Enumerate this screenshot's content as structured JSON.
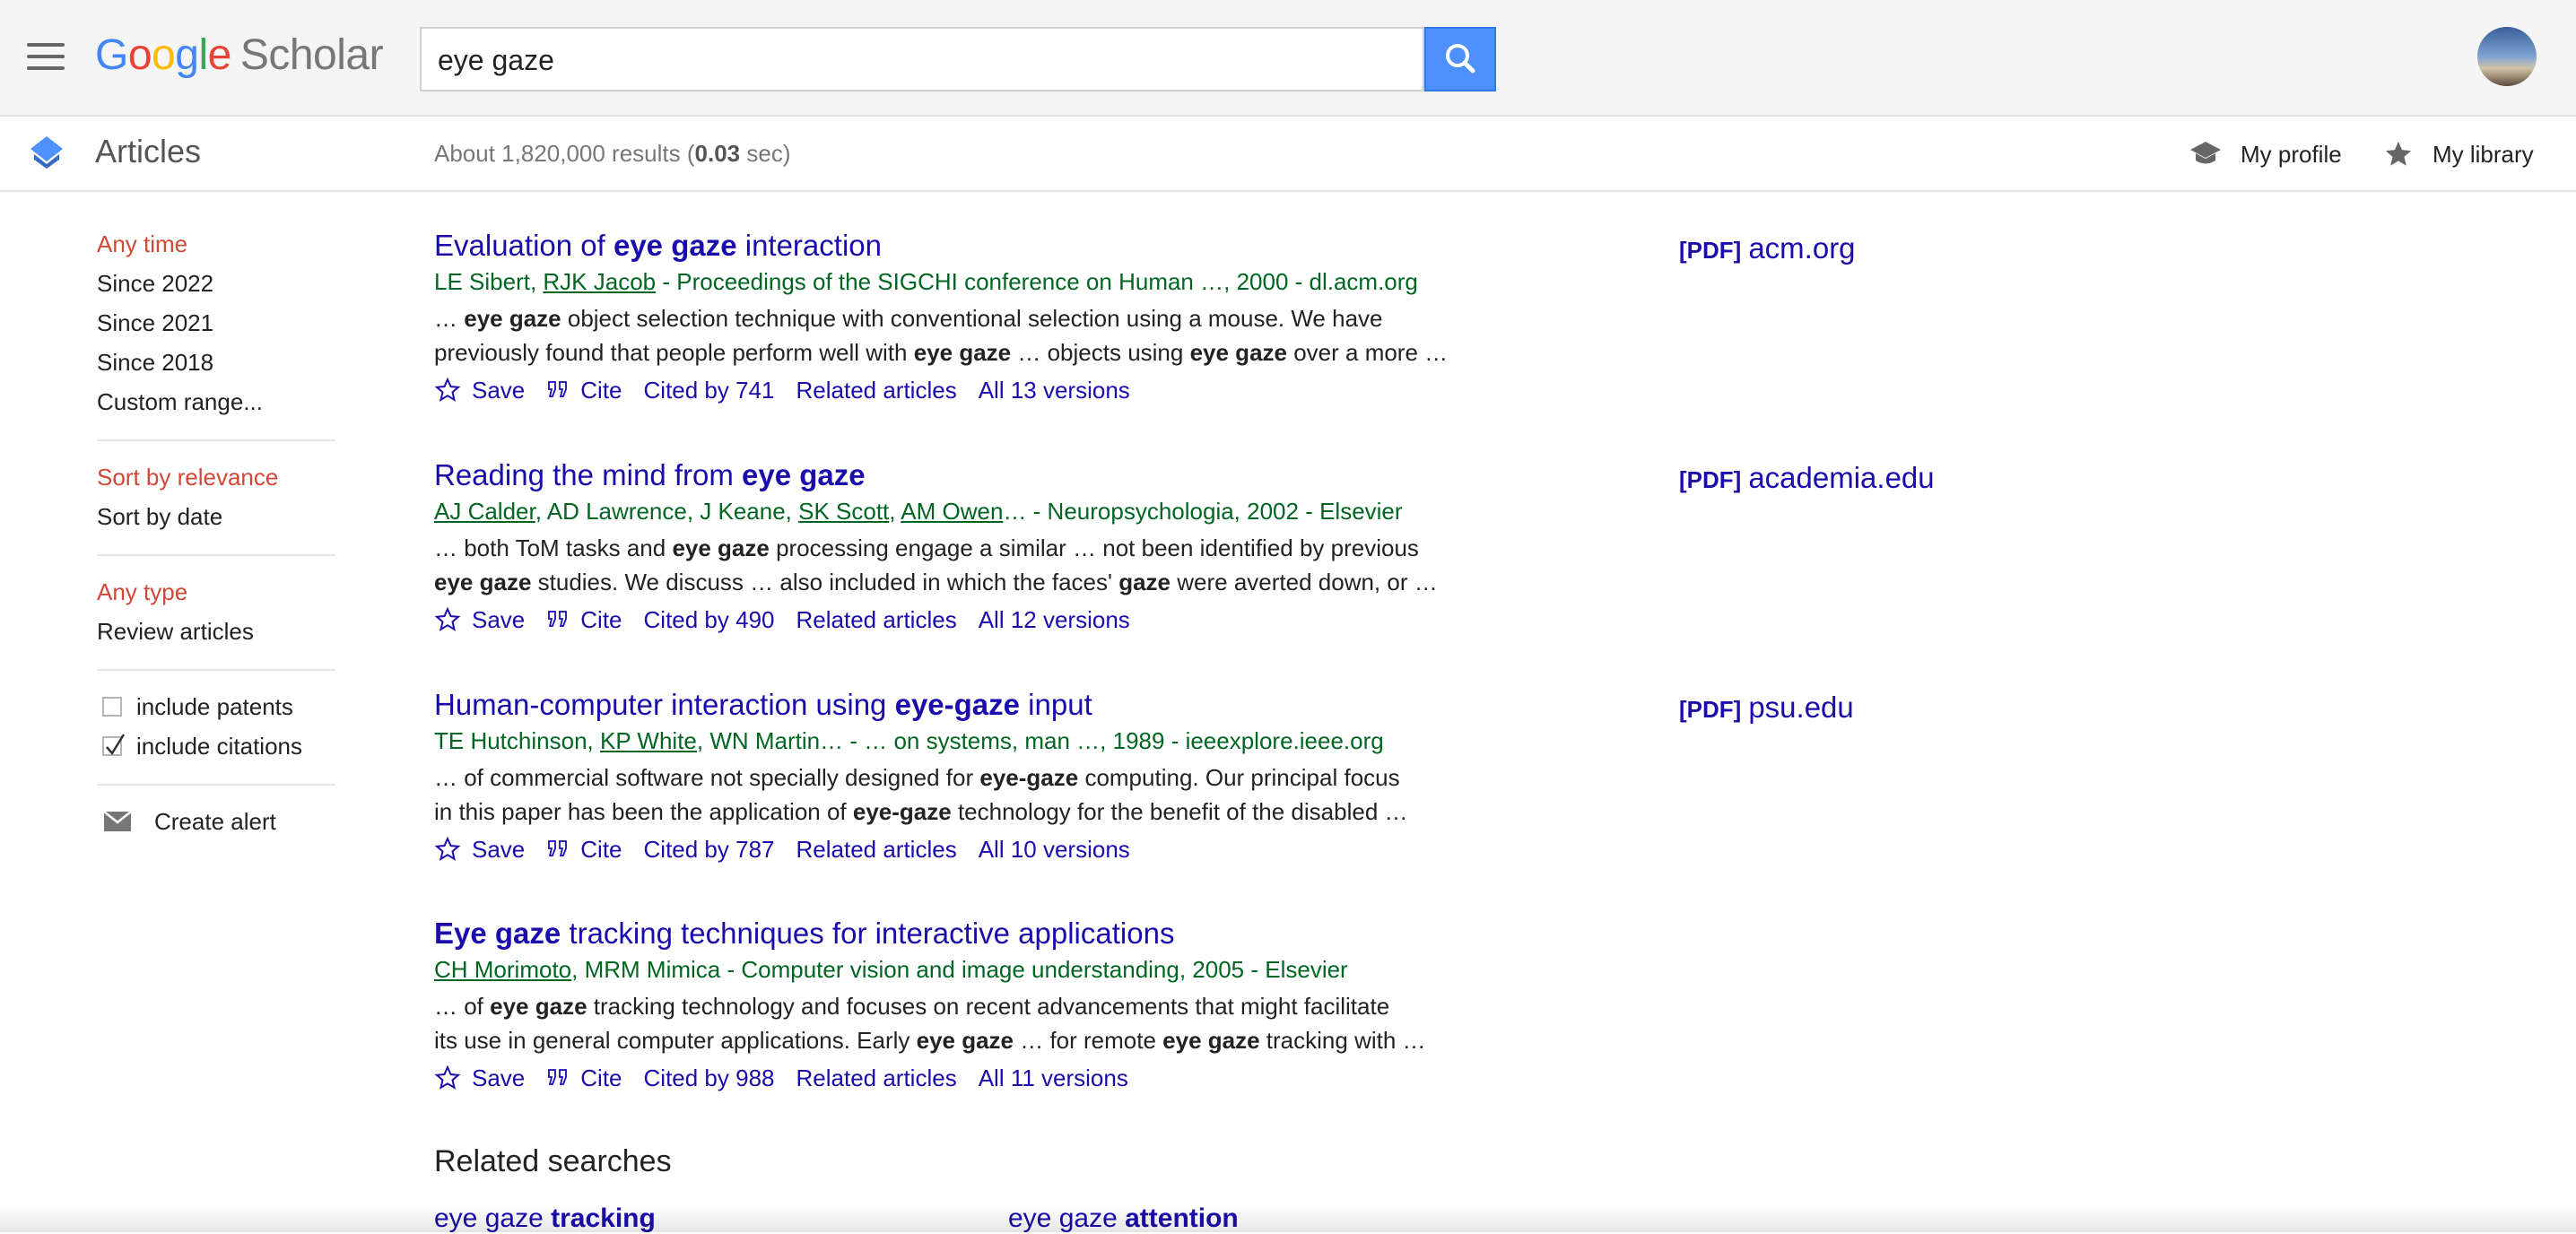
{
  "header": {
    "logo_google": [
      "G",
      "o",
      "o",
      "g",
      "l",
      "e"
    ],
    "logo_scholar": "Scholar",
    "search_value": "eye gaze"
  },
  "subheader": {
    "section_label": "Articles",
    "results_prefix": "About 1,820,000 results (",
    "results_time": "0.03",
    "results_suffix": " sec)",
    "my_profile": "My profile",
    "my_library": "My library"
  },
  "sidebar": {
    "time_filters": [
      "Any time",
      "Since 2022",
      "Since 2021",
      "Since 2018",
      "Custom range..."
    ],
    "sort_options": [
      "Sort by relevance",
      "Sort by date"
    ],
    "type_options": [
      "Any type",
      "Review articles"
    ],
    "include_patents": "include patents",
    "include_citations": "include citations",
    "create_alert": "Create alert"
  },
  "results": [
    {
      "title_parts": [
        "Evaluation of ",
        "eye gaze",
        " interaction"
      ],
      "authors_a": "LE Sibert",
      "authors_sep1": ", ",
      "authors_b": "RJK Jacob",
      "authors_rest": " - Proceedings of the SIGCHI conference on Human …, 2000 - dl.acm.org",
      "snippet_1": [
        "… ",
        "eye gaze",
        " object selection technique with conventional selection using a mouse. We have"
      ],
      "snippet_2": [
        "previously found that people perform well with ",
        "eye gaze",
        " … objects using ",
        "eye gaze",
        " over a more …"
      ],
      "save": "Save",
      "cite": "Cite",
      "cited_by": "Cited by 741",
      "related": "Related articles",
      "versions": "All 13 versions",
      "pdf_tag": "[PDF]",
      "pdf_domain": "acm.org"
    },
    {
      "title_parts": [
        "Reading the mind from ",
        "eye gaze",
        ""
      ],
      "authors_a": "AJ Calder",
      "authors_mid": ", AD Lawrence, J Keane, ",
      "authors_b": "SK Scott",
      "authors_sep2": ", ",
      "authors_c": "AM Owen",
      "authors_rest": "… - Neuropsychologia, 2002 - Elsevier",
      "snippet_1": [
        "… both ToM tasks and ",
        "eye gaze",
        " processing engage a similar … not been identified by previous"
      ],
      "snippet_2": [
        "eye gaze",
        " studies. We discuss … also included in which the faces' ",
        "gaze",
        " were averted down, or …"
      ],
      "save": "Save",
      "cite": "Cite",
      "cited_by": "Cited by 490",
      "related": "Related articles",
      "versions": "All 12 versions",
      "pdf_tag": "[PDF]",
      "pdf_domain": "academia.edu"
    },
    {
      "title_parts": [
        "Human-computer interaction using ",
        "eye-gaze",
        " input"
      ],
      "authors_a": "TE Hutchinson, ",
      "authors_b": "KP White",
      "authors_rest": ", WN Martin… - … on systems, man …, 1989 - ieeexplore.ieee.org",
      "snippet_1": [
        "… of commercial software not specially designed for ",
        "eye-gaze",
        " computing. Our principal focus"
      ],
      "snippet_2": [
        "in this paper has been the application of ",
        "eye-gaze",
        " technology for the benefit of the disabled …"
      ],
      "save": "Save",
      "cite": "Cite",
      "cited_by": "Cited by 787",
      "related": "Related articles",
      "versions": "All 10 versions",
      "pdf_tag": "[PDF]",
      "pdf_domain": "psu.edu"
    },
    {
      "title_parts": [
        "Eye gaze",
        " tracking techniques for interactive applications"
      ],
      "authors_a": "CH Morimoto",
      "authors_rest": ", MRM Mimica - Computer vision and image understanding, 2005 - Elsevier",
      "snippet_1": [
        "… of ",
        "eye gaze",
        " tracking technology and focuses on recent advancements that might facilitate"
      ],
      "snippet_2": [
        "its use in general computer applications. Early ",
        "eye gaze",
        " … for remote ",
        "eye gaze",
        " tracking with …"
      ],
      "save": "Save",
      "cite": "Cite",
      "cited_by": "Cited by 988",
      "related": "Related articles",
      "versions": "All 11 versions"
    }
  ],
  "related_searches": {
    "heading": "Related searches",
    "items": [
      {
        "prefix": "eye gaze ",
        "bold": "tracking"
      },
      {
        "prefix": "eye gaze ",
        "bold": "attention"
      }
    ]
  },
  "colors": {
    "link": "#1a0dab",
    "authors": "#006621",
    "active_filter": "#d14836",
    "search_button": "#4d90fe"
  },
  "icons": [
    "menu-icon",
    "search-icon",
    "articles-cap-icon",
    "graduation-cap-icon",
    "star-filled-icon",
    "star-outline-icon",
    "quote-icon",
    "envelope-icon",
    "checkmark-icon"
  ]
}
